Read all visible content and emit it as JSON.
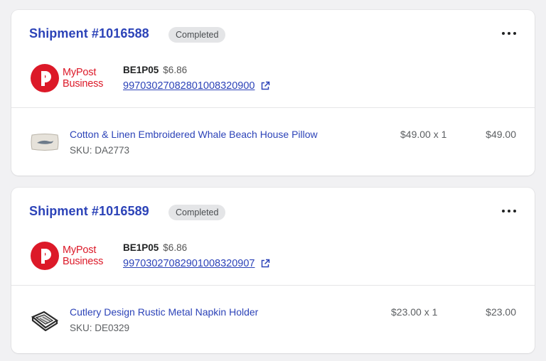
{
  "shipments": [
    {
      "title": "Shipment #1016588",
      "status": "Completed",
      "carrier_logo_text": [
        "MyPost",
        "Business"
      ],
      "service": "BE1P05",
      "shipping_price": "$6.86",
      "tracking_number": "99703027082801008320900",
      "item": {
        "name": "Cotton & Linen Embroidered Whale Beach House Pillow",
        "sku": "SKU: DA2773",
        "qty_price": "$49.00 x 1",
        "total": "$49.00"
      }
    },
    {
      "title": "Shipment #1016589",
      "status": "Completed",
      "carrier_logo_text": [
        "MyPost",
        "Business"
      ],
      "service": "BE1P05",
      "shipping_price": "$6.86",
      "tracking_number": "99703027082901008320907",
      "item": {
        "name": "Cutlery Design Rustic Metal Napkin Holder",
        "sku": "SKU: DE0329",
        "qty_price": "$23.00 x 1",
        "total": "$23.00"
      }
    }
  ],
  "icons": {
    "more": "more-horizontal-icon",
    "external_link": "external-link-icon",
    "carrier_logo": "mypost-business-logo"
  },
  "colors": {
    "accent": "#2c43b8",
    "logo_red": "#dc1928",
    "badge_bg": "#e4e5e7"
  }
}
